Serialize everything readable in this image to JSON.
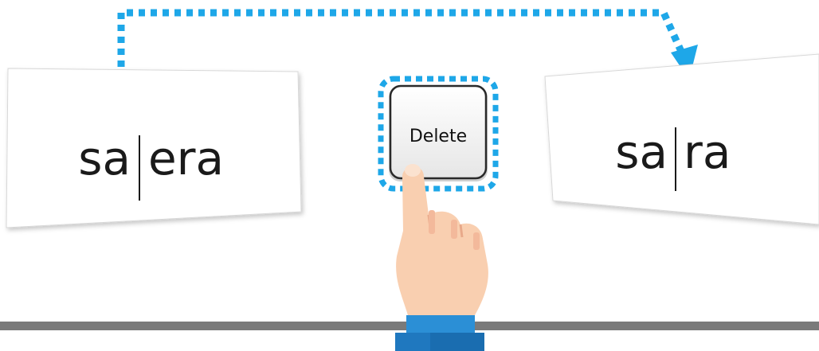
{
  "before": {
    "left": "sa",
    "right": "era"
  },
  "key": {
    "label": "Delete"
  },
  "after": {
    "left": "sa",
    "right": "ra"
  },
  "colors": {
    "accent_blue": "#1ea7e8",
    "skin": "#f9cfb0",
    "sleeve": "#2b8fd6",
    "floor": "#7a7a7a"
  }
}
